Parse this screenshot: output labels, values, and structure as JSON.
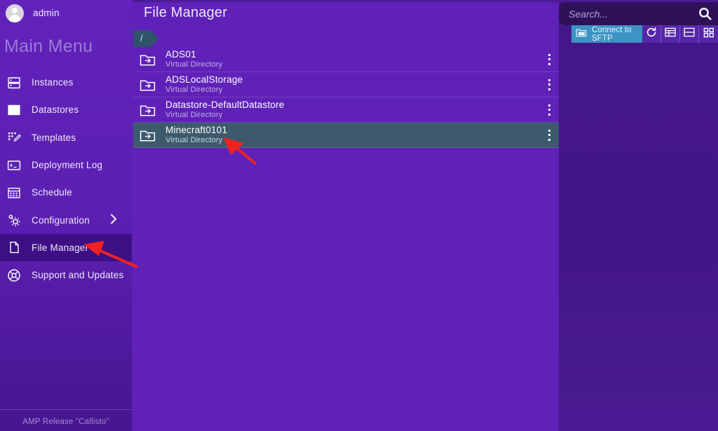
{
  "app": {
    "title": "File Manager",
    "footer": "AMP Release \"Callisto\""
  },
  "sidebar": {
    "user": "admin",
    "avatar_icon": "user-avatar-icon",
    "menu_title": "Main Menu",
    "items": [
      {
        "label": "Instances",
        "icon": "server-icon",
        "active": false,
        "has_chevron": false
      },
      {
        "label": "Datastores",
        "icon": "database-list-icon",
        "active": false,
        "has_chevron": false
      },
      {
        "label": "Templates",
        "icon": "template-edit-icon",
        "active": false,
        "has_chevron": false
      },
      {
        "label": "Deployment Log",
        "icon": "terminal-icon",
        "active": false,
        "has_chevron": false
      },
      {
        "label": "Schedule",
        "icon": "calendar-icon",
        "active": false,
        "has_chevron": false
      },
      {
        "label": "Configuration",
        "icon": "gear-icon",
        "active": false,
        "has_chevron": true
      },
      {
        "label": "File Manager",
        "icon": "file-icon",
        "active": true,
        "has_chevron": false
      },
      {
        "label": "Support and Updates",
        "icon": "lifebuoy-icon",
        "active": false,
        "has_chevron": false
      }
    ]
  },
  "breadcrumb": {
    "items": [
      {
        "label": "/"
      }
    ]
  },
  "files": {
    "rows": [
      {
        "name": "ADS01",
        "type": "Virtual Directory",
        "icon": "folder-link-icon",
        "selected": false
      },
      {
        "name": "ADSLocalStorage",
        "type": "Virtual Directory",
        "icon": "folder-link-icon",
        "selected": false
      },
      {
        "name": "Datastore-DefaultDatastore",
        "type": "Virtual Directory",
        "icon": "folder-link-icon",
        "selected": false
      },
      {
        "name": "Minecraft0101",
        "type": "Virtual Directory",
        "icon": "folder-link-icon",
        "selected": true
      }
    ],
    "row_menu_icon": "kebab-menu-icon"
  },
  "search": {
    "placeholder": "Search...",
    "value": "",
    "icon": "search-icon"
  },
  "toolbar": {
    "sftp_label": "Connect to SFTP",
    "sftp_icon": "folder-image-icon",
    "buttons": [
      {
        "name": "refresh",
        "icon": "refresh-icon"
      },
      {
        "name": "list-view",
        "icon": "table-view-icon"
      },
      {
        "name": "split-view",
        "icon": "split-view-icon"
      },
      {
        "name": "grid-view",
        "icon": "grid-view-icon"
      }
    ]
  },
  "colors": {
    "sidebar": "#6021ba",
    "main": "#5f21b8",
    "right_panel": "#431688",
    "active_nav": "#3c0f85",
    "selected_row": "#3d5a6c",
    "breadcrumb": "#2f5369",
    "sftp_button": "#3d93c4",
    "search_bg": "#2e1158",
    "annotation": "#ef2222"
  }
}
